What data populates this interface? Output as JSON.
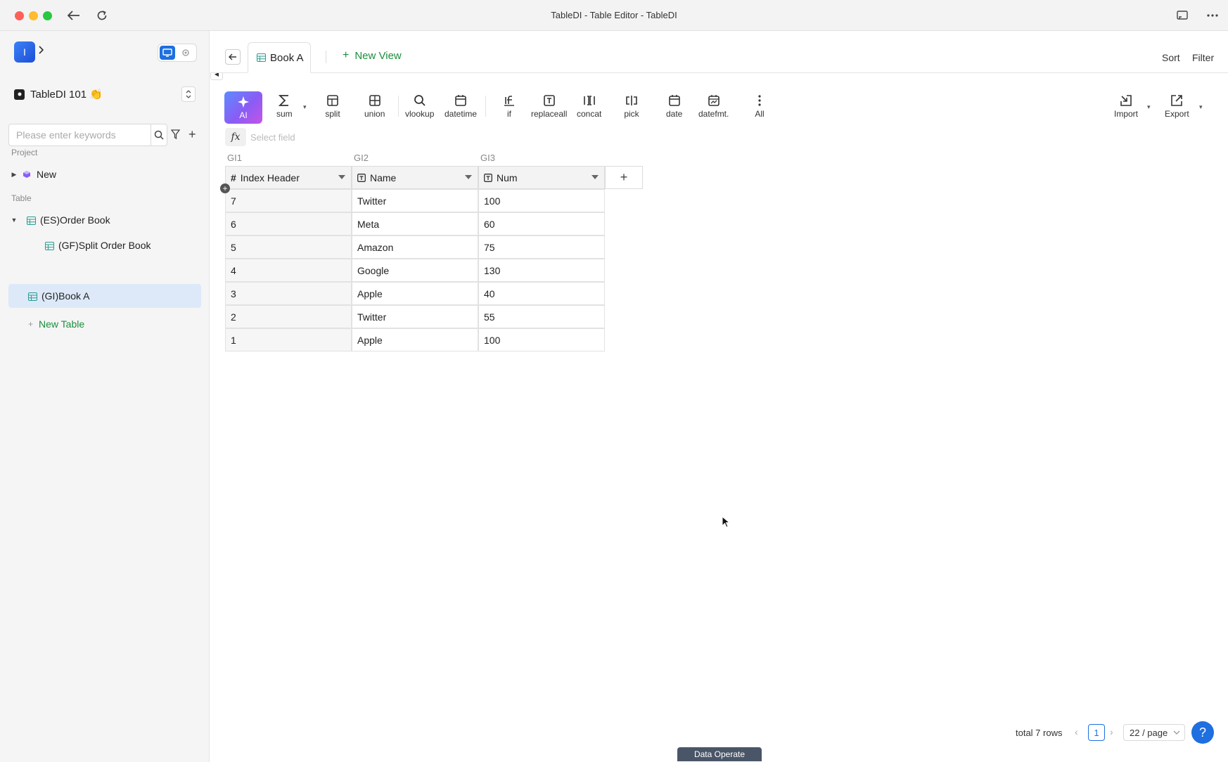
{
  "window": {
    "title": "TableDI - Table Editor - TableDI"
  },
  "sidebar": {
    "logo_letter": "I",
    "project_name": "TableDI 101 👏",
    "search_placeholder": "Please enter keywords",
    "project_label": "Project",
    "project_items": [
      {
        "label": "New"
      }
    ],
    "table_label": "Table",
    "tables": [
      {
        "label": "(ES)Order Book"
      },
      {
        "label": "(GF)Split Order Book"
      },
      {
        "label": "(GI)Book A"
      }
    ],
    "new_table_label": "New Table"
  },
  "tabs": {
    "active_label": "Book A",
    "new_view_label": "New View",
    "sort_label": "Sort",
    "filter_label": "Filter"
  },
  "toolbar": {
    "ai_label": "AI",
    "buttons": [
      "sum",
      "split",
      "union",
      "vlookup",
      "datetime",
      "if",
      "replaceall",
      "concat",
      "pick",
      "date",
      "datefmt.",
      "All"
    ],
    "import_label": "Import",
    "export_label": "Export"
  },
  "formula": {
    "fx_label": "fx",
    "placeholder": "Select field"
  },
  "grid": {
    "column_ids": [
      "GI1",
      "GI2",
      "GI3"
    ],
    "headers": [
      "Index Header",
      "Name",
      "Num"
    ],
    "rows": [
      [
        "7",
        "Twitter",
        "100"
      ],
      [
        "6",
        "Meta",
        "60"
      ],
      [
        "5",
        "Amazon",
        "75"
      ],
      [
        "4",
        "Google",
        "130"
      ],
      [
        "3",
        "Apple",
        "40"
      ],
      [
        "2",
        "Twitter",
        "55"
      ],
      [
        "1",
        "Apple",
        "100"
      ]
    ]
  },
  "footer": {
    "total_rows": "total 7 rows",
    "current_page": "1",
    "page_size": "22 / page",
    "help": "?",
    "data_operate": "Data Operate"
  },
  "colors": {
    "accent": "#1e6fe0",
    "green": "#1a8f3c",
    "selected_row": "#dde9f9"
  }
}
